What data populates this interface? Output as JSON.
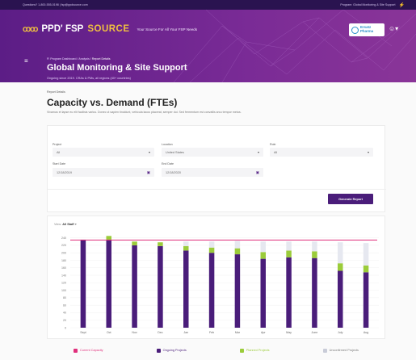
{
  "utilbar": {
    "left_text": "Questions? 1-800-555-0198 | fsp@ppdsource.com",
    "right_text": "Program: Global Monitoring & Site Support"
  },
  "brand": {
    "mark": "ꝏꝏ",
    "ppd": "PPD' FSP",
    "source": "SOURCE",
    "tagline": "Your Source For All Your FSP Needs"
  },
  "client_logo": {
    "name": "Ersatz",
    "sub": "Pharma"
  },
  "header": {
    "breadcrumb": [
      "FI Program Dashboard",
      "Analysis",
      "Report Details"
    ],
    "title": "Global Monitoring & Site Support",
    "subtitle": "Ongoing since 2019. CRAs & PMs, all regions (40+ countries)"
  },
  "report": {
    "label": "Report Details",
    "title": "Capacity vs. Demand (FTEs)",
    "description": "Vivamus et lapse eu elit facilisis varius. Donec ut sapien tincidunt, vehicula lacus placerat, semper dui. Sed fermentum est convallis arcu tempor metus."
  },
  "filters": {
    "project": {
      "label": "Project",
      "value": "All"
    },
    "location": {
      "label": "Location",
      "value": "United States"
    },
    "role": {
      "label": "Role",
      "value": "All"
    },
    "start_date": {
      "label": "Start Date",
      "value": "12/18/2019"
    },
    "end_date": {
      "label": "End Date",
      "value": "12/18/2020"
    },
    "generate": "Generate Report"
  },
  "view": {
    "label": "View:",
    "value": "All Staff"
  },
  "legend": [
    {
      "label": "Current Capacity",
      "color": "#e02f7c"
    },
    {
      "label": "Ongoing Projects",
      "color": "#4a1d7a"
    },
    {
      "label": "Planned Projects",
      "color": "#9bcc3a"
    },
    {
      "label": "Unconfirmed Projects",
      "color": "#e6e8f0"
    }
  ],
  "chart_data": {
    "type": "bar",
    "stacked": true,
    "categories": [
      "Sept",
      "Oct",
      "Nov",
      "Dec",
      "Jan",
      "Feb",
      "Mar",
      "Apr",
      "May",
      "June",
      "July",
      "Aug"
    ],
    "series": [
      {
        "name": "Ongoing Projects",
        "color": "#4a1d7a",
        "values": [
          235,
          235,
          220,
          218,
          206,
          200,
          196,
          184,
          188,
          186,
          152,
          148
        ]
      },
      {
        "name": "Planned Projects",
        "color": "#9bcc3a",
        "values": [
          0,
          10,
          10,
          10,
          12,
          14,
          16,
          18,
          18,
          18,
          20,
          18
        ]
      },
      {
        "name": "Unconfirmed Projects",
        "color": "#e6e8f0",
        "values": [
          0,
          0,
          0,
          0,
          12,
          16,
          20,
          28,
          24,
          26,
          56,
          60
        ]
      }
    ],
    "capacity_line": 234,
    "yticks": [
      0,
      20,
      40,
      60,
      80,
      100,
      120,
      140,
      160,
      180,
      200,
      220,
      240
    ],
    "ylim": [
      0,
      250
    ]
  }
}
